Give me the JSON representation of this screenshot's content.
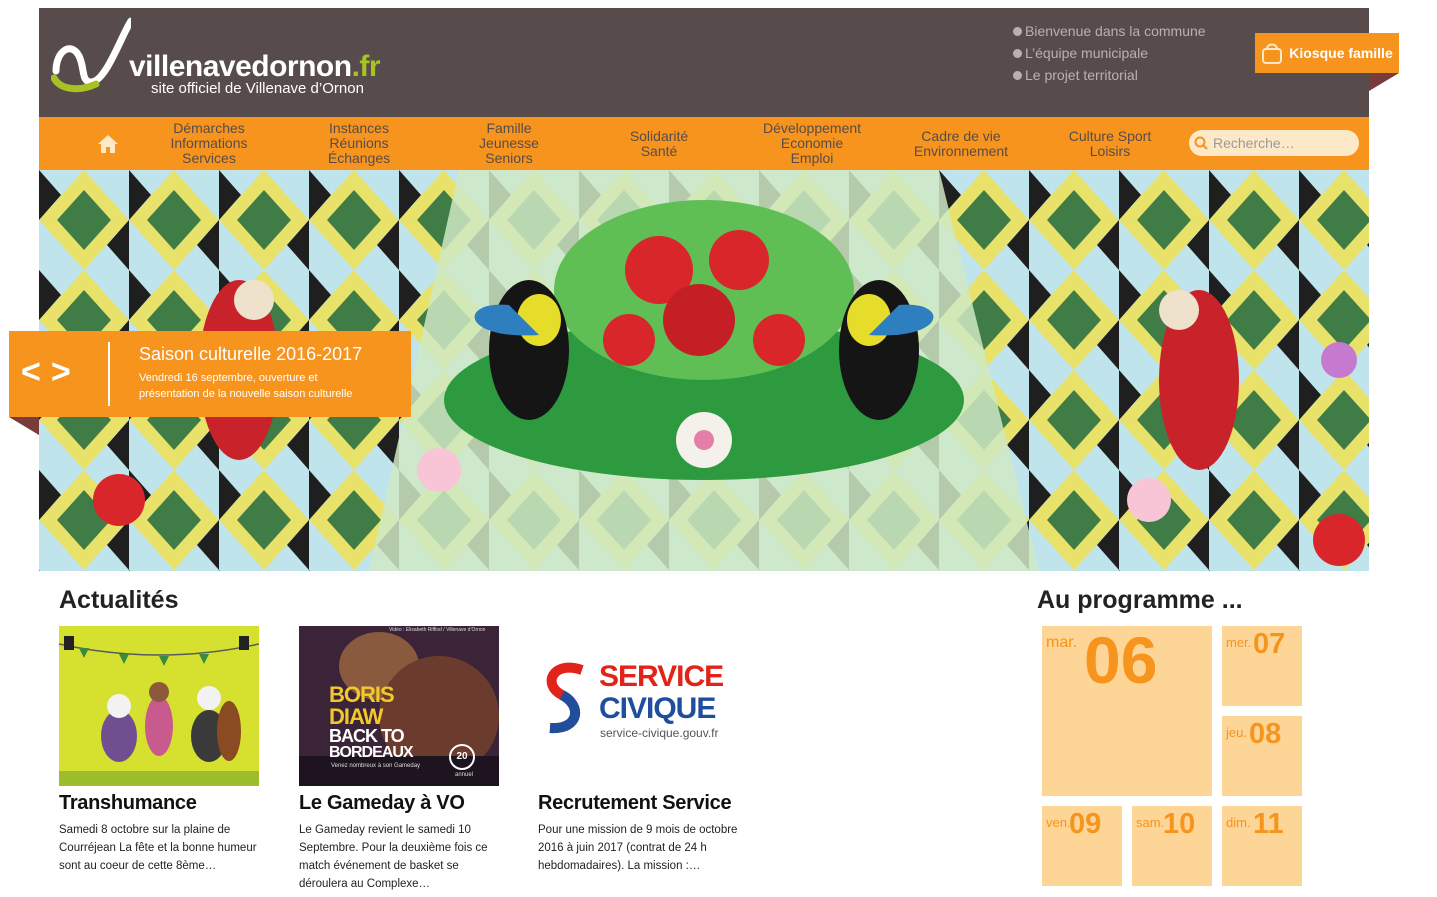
{
  "site": {
    "logo_name": "villenavedornon",
    "logo_tld": ".fr",
    "logo_tagline": "site officiel de Villenave d’Ornon"
  },
  "top_links": [
    "Bienvenue dans la commune",
    "L’équipe municipale",
    "Le projet territorial"
  ],
  "kiosque_label": "Kiosque famille",
  "nav": {
    "home_icon": "home-icon",
    "items": [
      "Démarches\nInformations\nServices",
      "Instances\nRéunions\nÉchanges",
      "Famille\nJeunesse\nSeniors",
      "Solidarité\nSanté",
      "Développement\nEconomie\nEmploi",
      "Cadre de vie\nEnvironnement",
      "Culture Sport\nLoisirs"
    ],
    "search_placeholder": "Recherche…"
  },
  "slider": {
    "prev": "<",
    "next": ">",
    "title": "Saison culturelle 2016-2017",
    "text": "Vendredi 16 septembre, ouverture et présentation de la nouvelle saison culturelle"
  },
  "news": {
    "heading": "Actualités",
    "items": [
      {
        "title": "Transhumance",
        "text": "Samedi 8 octobre sur la plaine de Courréjean La fête et la bonne humeur sont au coeur de cette 8ème…"
      },
      {
        "title": "Le Gameday à VO",
        "text": "Le Gameday revient le samedi 10 Septembre. Pour la deuxième fois ce match événement de basket se déroulera au Complexe…",
        "image_text": {
          "line1": "BORIS",
          "line2": "DIAW",
          "line3": "BACK TO",
          "line4": "BORDEAUX",
          "line5": "Venez nombreux à son Gameday",
          "badge": "20",
          "badge_sub": "annuel",
          "credit": "Vidéo : Elisabeth Rifflod / Villenave d’Ornon"
        }
      },
      {
        "title": "Recrutement Service",
        "text": "Pour une mission de 9 mois de octobre 2016 à juin 2017 (contrat de 24 h hebdomadaires). La mission :…",
        "image_text": {
          "line1": "SERVICE",
          "line2": "CIVIQUE",
          "url": "service-civique.gouv.fr"
        }
      }
    ]
  },
  "agenda": {
    "heading": "Au programme ...",
    "days": [
      {
        "wd": "mar.",
        "num": "06"
      },
      {
        "wd": "mer.",
        "num": "07"
      },
      {
        "wd": "jeu.",
        "num": "08"
      },
      {
        "wd": "ven.",
        "num": "09"
      },
      {
        "wd": "sam.",
        "num": "10"
      },
      {
        "wd": "dim.",
        "num": "11"
      }
    ]
  },
  "colors": {
    "orange": "#f7941d",
    "header_brown": "#574c4b",
    "agenda_tile": "#fdd596",
    "logo_green": "#a8c224"
  }
}
